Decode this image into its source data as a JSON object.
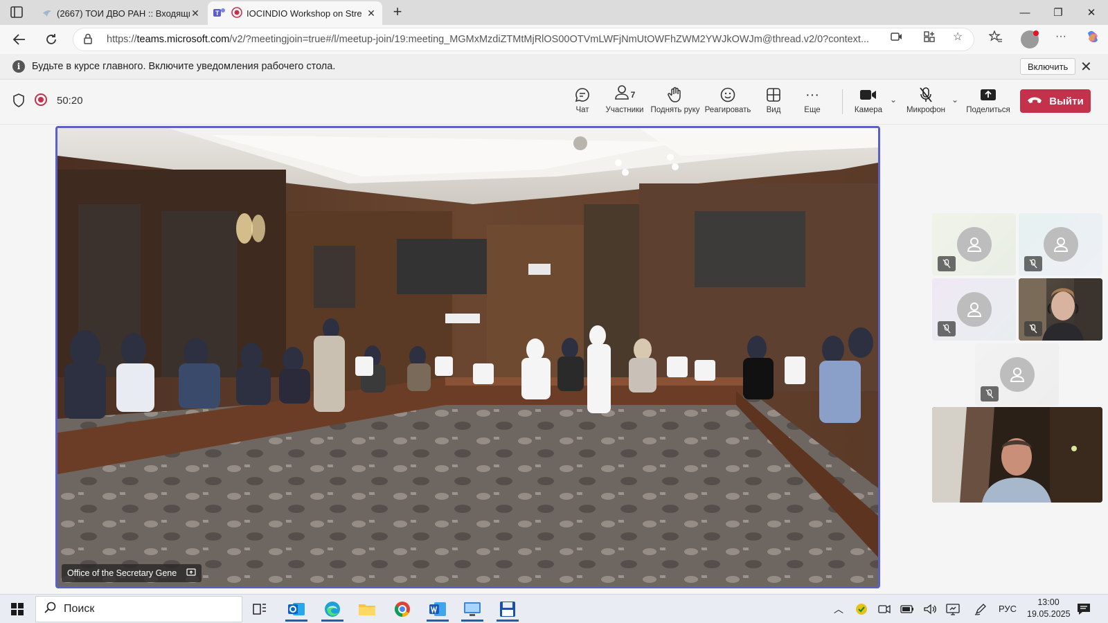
{
  "browser": {
    "tabs": [
      {
        "title": "(2667) ТОИ ДВО РАН :: Входящие",
        "active": false
      },
      {
        "title": "IOCINDIO Workshop on Stre",
        "active": true
      }
    ],
    "new_tab": "+",
    "url": {
      "prefix": "https://",
      "host": "teams.microsoft.com",
      "path": "/v2/?meetingjoin=true#/l/meetup-join/19:meeting_MGMxMzdiZTMtMjRlOS00OTVmLWFjNmUtOWFhZWM2YWJkOWJm@thread.v2/0?context..."
    }
  },
  "infobar": {
    "message": "Будьте в курсе главного. Включите уведомления рабочего стола.",
    "enable_label": "Включить"
  },
  "meeting": {
    "timer": "50:20",
    "toolbar": {
      "chat": "Чат",
      "participants": "Участники",
      "participants_count": "7",
      "raise_hand": "Поднять руку",
      "react": "Реагировать",
      "view": "Вид",
      "more": "Еще",
      "camera": "Камера",
      "mic": "Микрофон",
      "share": "Поделиться",
      "leave": "Выйти"
    },
    "main_video_name": "Office of the Secretary Gene",
    "colors": {
      "accent": "#5b5fc7",
      "leave": "#c4314b"
    }
  },
  "taskbar": {
    "search_placeholder": "Поиск",
    "lang": "РУС",
    "time": "13:00",
    "date": "19.05.2025"
  }
}
